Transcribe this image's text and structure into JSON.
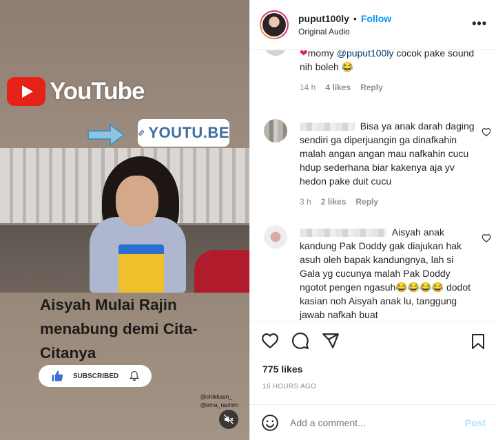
{
  "media": {
    "youtube_word": "YouTube",
    "link_text": "YOUTU.BE",
    "caption": "Aisyah Mulai Rajin menabung demi Cita-Citanya",
    "subscribe_label": "SUBSCRIBED",
    "credit_1": "@chikkasn_",
    "credit_2": "@irma_rachim"
  },
  "header": {
    "username": "puput100ly",
    "separator": "•",
    "follow_label": "Follow",
    "audio": "Original Audio",
    "more_icon": "more-horizontal-icon"
  },
  "comments": [
    {
      "user": "",
      "text": "momy @puput100ly cocok pake sound nih boleh 😂",
      "prefix": "❤",
      "mention": "@puput100ly",
      "text_before": "momy ",
      "text_after": " cocok pake sound nih boleh 😂",
      "time": "14 h",
      "likes": "4 likes",
      "reply": "Reply"
    },
    {
      "text": "Bisa ya anak darah daging sendiri ga diperjuangin ga dinafkahin malah angan angan mau nafkahin cucu hdup sederhana biar kakenya aja yv hedon pake duit cucu",
      "time": "3 h",
      "likes": "2 likes",
      "reply": "Reply"
    },
    {
      "text": "Aisyah anak kandung Pak Doddy gak diajukan hak asuh oleh bapak kandungnya, lah si Gala yg cucunya malah Pak Doddy ngotot pengen ngasuh😂😂😂😂 dodot kasian noh Aisyah anak lu, tanggung jawab nafkah buat"
    }
  ],
  "actions": {
    "likes": "775 likes",
    "time": "16 HOURS AGO",
    "comment_placeholder": "Add a comment...",
    "post_label": "Post"
  },
  "colors": {
    "accent": "#0095f6",
    "post_disabled": "#b2dffc",
    "youtube_red": "#e62117"
  }
}
